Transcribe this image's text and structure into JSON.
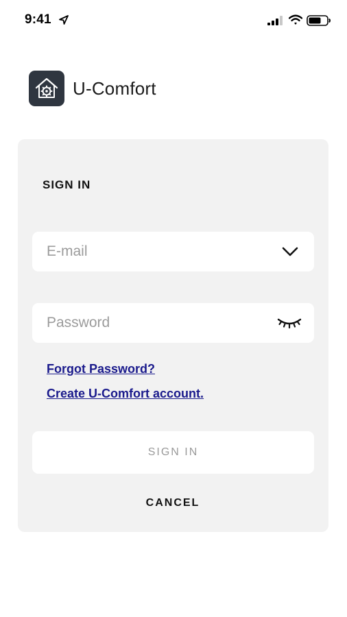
{
  "status_bar": {
    "time": "9:41",
    "icons": [
      "location-arrow-icon",
      "cellular-signal-icon",
      "wifi-icon",
      "battery-icon"
    ]
  },
  "brand": {
    "name": "U-Comfort",
    "logo_icon": "house-gear-icon",
    "logo_color": "#2f3640"
  },
  "signin_form": {
    "title": "SIGN IN",
    "email": {
      "value": "",
      "placeholder": "E-mail",
      "icon": "chevron-down-icon"
    },
    "password": {
      "value": "",
      "placeholder": "Password",
      "icon": "eye-closed-icon"
    },
    "forgot_password_label": "Forgot Password?",
    "create_account_label": "Create U-Comfort account.",
    "submit_label": "SIGN IN",
    "cancel_label": "CANCEL"
  },
  "colors": {
    "card_background": "#f2f2f2",
    "link": "#1a1a8c",
    "placeholder": "#9b9b9b",
    "disabled_button_text": "#9a9a9a"
  }
}
